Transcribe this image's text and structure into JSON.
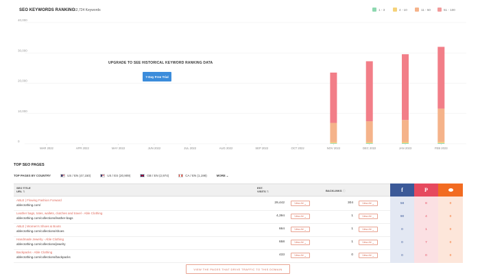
{
  "header": {
    "title": "SEO KEYWORDS RANKING",
    "keyword_count": "52,724 Keywords"
  },
  "legend": [
    {
      "label": "1 - 3",
      "color": "#8ed8b0"
    },
    {
      "label": "4 - 10",
      "color": "#f5d27a"
    },
    {
      "label": "11 - 50",
      "color": "#f5b38a"
    },
    {
      "label": "51 - 100",
      "color": "#f29a9a"
    }
  ],
  "upgrade": {
    "message": "UPGRADE TO SEE HISTORICAL KEYWORD RANKING DATA",
    "button_label": "7-Day Free Trial"
  },
  "chart_data": {
    "type": "bar",
    "stacked": true,
    "categories": [
      "MAR 2022",
      "APR 2022",
      "MAY 2022",
      "JUN 2022",
      "JUL 2022",
      "AUG 2022",
      "SEP 2022",
      "OCT 2022",
      "NOV 2022",
      "DEC 2022",
      "JAN 2023",
      "FEB 2023"
    ],
    "series": [
      {
        "name": "1 - 3",
        "color": "#8ed8b0",
        "values": [
          0,
          0,
          0,
          0,
          0,
          0,
          0,
          0,
          200,
          220,
          230,
          240
        ]
      },
      {
        "name": "4 - 10",
        "color": "#f5d27a",
        "values": [
          0,
          0,
          0,
          0,
          0,
          0,
          0,
          0,
          300,
          320,
          330,
          360
        ]
      },
      {
        "name": "11 - 50",
        "color": "#f5b38a",
        "values": [
          0,
          0,
          0,
          0,
          0,
          0,
          0,
          0,
          6400,
          6900,
          7300,
          11000
        ]
      },
      {
        "name": "51 - 100",
        "color": "#f27e88",
        "values": [
          0,
          0,
          0,
          0,
          0,
          0,
          0,
          0,
          16600,
          19800,
          21700,
          20400
        ]
      }
    ],
    "ylim": [
      0,
      40000
    ],
    "yticks": [
      "0",
      "10,000",
      "20,000",
      "30,000",
      "40,000"
    ],
    "grid": true
  },
  "top_pages": {
    "title": "TOP SEO PAGES",
    "by_country_label": "TOP PAGES BY COUNTRY",
    "countries": [
      {
        "label": "US / EN (47,150)",
        "flag": "us"
      },
      {
        "label": "US / ES (20,909)",
        "flag": "us"
      },
      {
        "label": "GB / EN (2,974)",
        "flag": "gb"
      },
      {
        "label": "CA / EN (1,198)",
        "flag": "ca"
      }
    ],
    "more_label": "MORE",
    "columns": {
      "title_label": "SEO TITLE",
      "url_label": "URL",
      "visits_label_1": "EST.",
      "visits_label_2": "VISITS",
      "backlinks_label": "BACKLINKS"
    },
    "view_all_label": "View All",
    "rows": [
      {
        "title": "ABLE | Flowing Fashion Forward",
        "url": "ablecIothing.com/",
        "visits": "29,442",
        "backlinks": "304",
        "fb": "58",
        "pin": "8",
        "reddit": "0"
      },
      {
        "title": "Leather bags, totes, wallets, clutches and travel - Able Clothing",
        "url": "ablecIothing.com/collections/leather-bags",
        "visits": "4,394",
        "backlinks": "1",
        "fb": "90",
        "pin": "4",
        "reddit": "0"
      },
      {
        "title": "ABLE | Women's Shoes & Boots",
        "url": "ablecIothing.com/collections/shoes",
        "visits": "664",
        "backlinks": "1",
        "fb": "0",
        "pin": "1",
        "reddit": "0"
      },
      {
        "title": "Handmade Jewelry - Able Clothing",
        "url": "ablecIothing.com/collections/jewelry",
        "visits": "658",
        "backlinks": "1",
        "fb": "0",
        "pin": "7",
        "reddit": "0"
      },
      {
        "title": "Backpacks - Able Clothing",
        "url": "ablecIothing.com/collections/backpacks",
        "visits": "433",
        "backlinks": "0",
        "fb": "0",
        "pin": "0",
        "reddit": "0"
      }
    ],
    "social_colors": {
      "facebook": "#3b5998",
      "pinterest": "#e6495e",
      "reddit": "#f26b21"
    },
    "footer_button": "VIEW THE PAGES THAT DRIVE TRAFFIC TO THIS DOMAIN"
  }
}
